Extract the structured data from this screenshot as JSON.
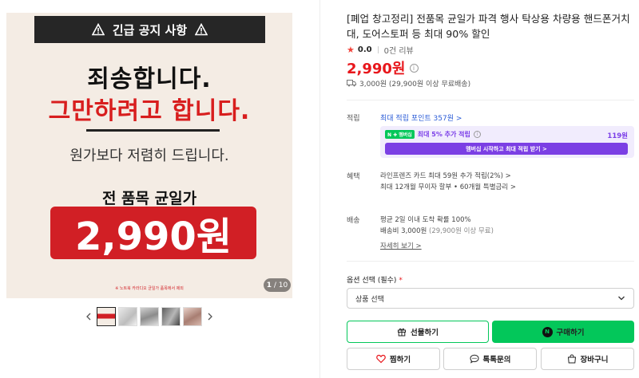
{
  "image": {
    "notice_title": "긴급 공지 사항",
    "headline": "죄송합니다.",
    "headline_red": "그만하려고 합니다.",
    "subline": "원가보다 저렴히 드립니다.",
    "all_items": "전 품목 균일가",
    "price_banner": "2,990원",
    "fine_print": "※ 노트북 카라디오 균일가 품목에서 제외",
    "counter_current": "1",
    "counter_total": "/ 10"
  },
  "thumbnails": [
    "thumb-1",
    "thumb-2",
    "thumb-3",
    "thumb-4",
    "thumb-5"
  ],
  "product": {
    "title": "[폐업 창고정리] 전품목 균일가 파격 행사 탁상용 차량용 핸드폰거치대, 도어스토퍼 등 최대 90% 할인",
    "rating_score": "0.0",
    "review_count": "0건 리뷰",
    "price": "2,990원",
    "shipping": "3,000원 (29,900원 이상 무료배송)"
  },
  "points": {
    "label": "적립",
    "link": "최대 적립 포인트 357원 >",
    "badge": "N ✚ 멤버십",
    "promo_text": "최대 5% 추가 적립",
    "promo_amount": "119원",
    "promo_button": "멤버십 시작하고 최대 적립 받기 >"
  },
  "benefits": {
    "label": "혜택",
    "line1": "라인프렌즈 카드 최대 59원 추가 적립(2%) >",
    "line2": "최대 12개월 무이자 할부 • 60개월 특별금리 >"
  },
  "delivery": {
    "label": "배송",
    "line1": "평균 2일 이내 도착 확률 100%",
    "line2_main": "배송비 3,000원",
    "line2_sub": "(29,900원 이상 무료)",
    "detail_link": "자세히 보기 >"
  },
  "options": {
    "label": "옵션 선택 (필수)",
    "required_mark": "*",
    "select_value": "상품 선택"
  },
  "buttons": {
    "gift": "선물하기",
    "buy": "구매하기",
    "wish": "찜하기",
    "talk": "톡톡문의",
    "cart": "장바구니"
  },
  "colors": {
    "price_red": "#e8171c",
    "naver_green": "#03c75a",
    "membership_purple": "#7b3fe4",
    "banner_red": "#d11f25"
  }
}
